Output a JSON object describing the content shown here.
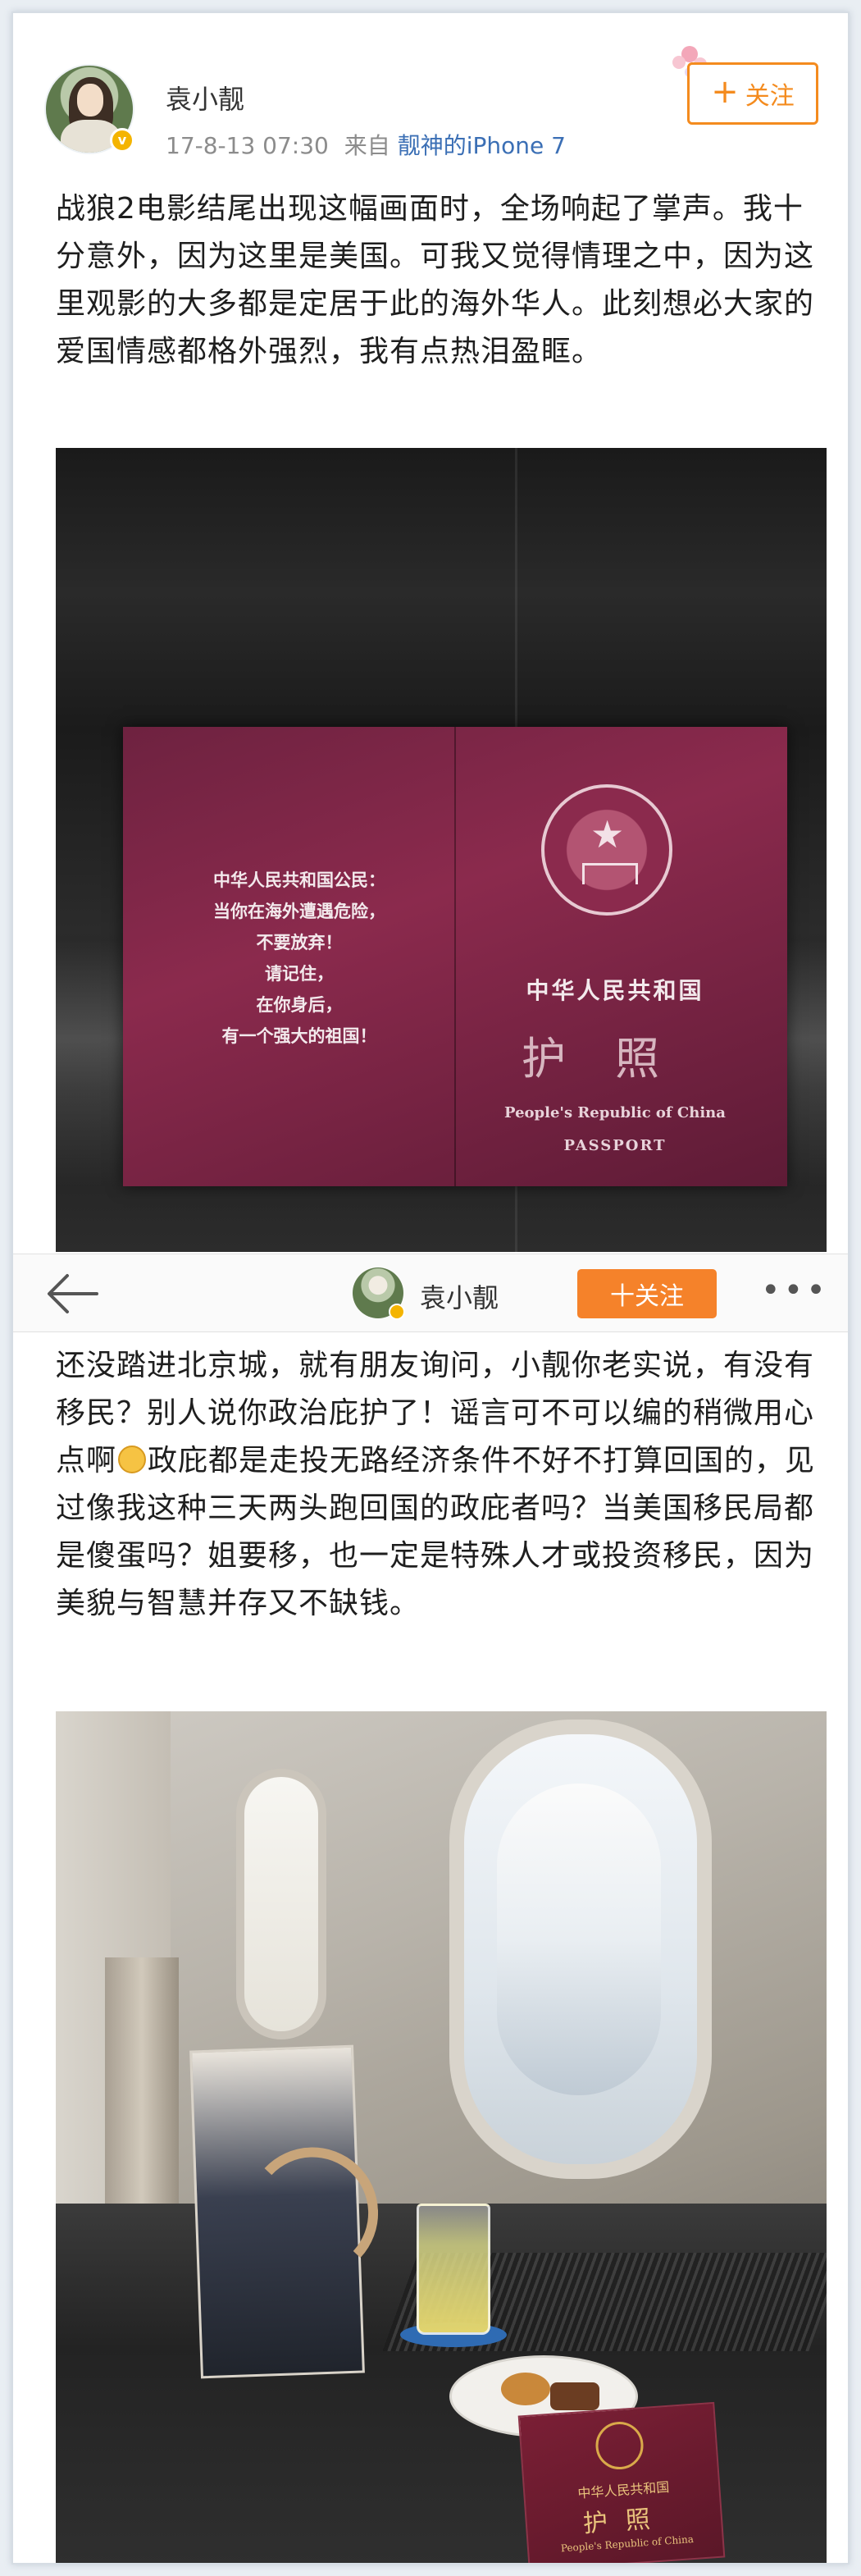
{
  "post1": {
    "user_name": "袁小靓",
    "time": "17-8-13 07:30",
    "source_prefix": "来自",
    "source": "靓神的iPhone 7",
    "follow_plus": "+",
    "follow_label": "关注",
    "text": "战狼2电影结尾出现这幅画面时，全场响起了掌声。我十分意外，因为这里是美国。可我又觉得情理之中，因为这里观影的大多都是定居于此的海外华人。此刻想必大家的爱国情感都格外强烈，我有点热泪盈眶。",
    "photo": {
      "passport_message_lines": [
        "中华人民共和国公民：",
        "当你在海外遭遇危险，",
        "不要放弃！",
        "请记住，",
        "在你身后，",
        "有一个强大的祖国！"
      ],
      "passport_title": "中华人民共和国",
      "passport_huzhao": "护照",
      "passport_english": "People's Republic of China",
      "passport_word": "PASSPORT"
    }
  },
  "navbar": {
    "user_name": "袁小靓",
    "follow_label": "十关注",
    "more": "•••"
  },
  "post2": {
    "text_before_emoji": "还没踏进北京城，就有朋友询问，小靓你老实说，有没有移民？别人说你政治庇护了！谣言可不可以编的稍微用心点啊",
    "text_after_emoji": "政庇都是走投无路经济条件不好不打算回国的，见过像我这种三天两头跑回国的政庇者吗？当美国移民局都是傻蛋吗？姐要移，也一定是特殊人才或投资移民，因为美貌与智慧并存又不缺钱。",
    "photo": {
      "mini_passport_title": "中华人民共和国",
      "mini_passport_huzhao": "护照",
      "mini_passport_english": "People's Republic of China"
    }
  },
  "colors": {
    "accent_orange": "#f48b1e",
    "link_blue": "#3b6fb5",
    "verified_gold": "#f4b400"
  }
}
